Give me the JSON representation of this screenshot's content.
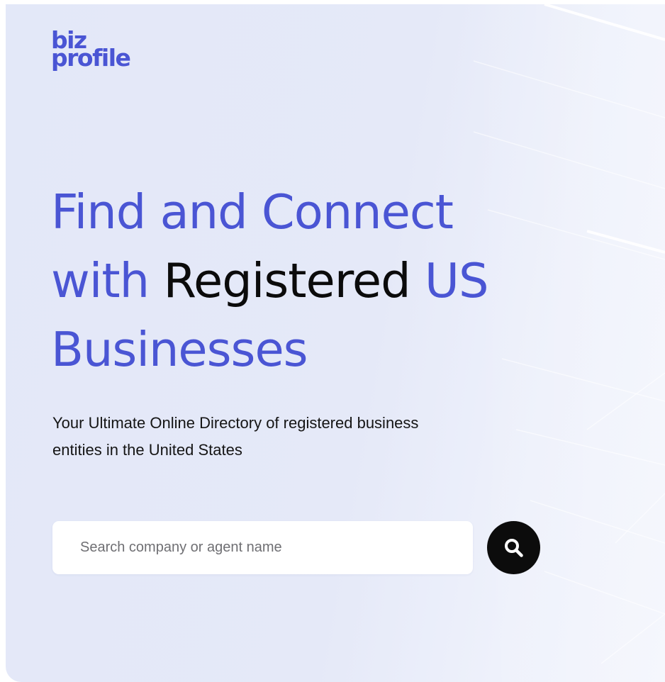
{
  "brand": {
    "logo_line1": "biz",
    "logo_line2": "profile",
    "color": "#4a55d4"
  },
  "hero": {
    "headline_part1": "Find and Connect",
    "headline_part2": "with",
    "headline_highlight": "Registered",
    "headline_part3": "US",
    "headline_part4": "Businesses",
    "subtitle": "Your Ultimate Online Directory of registered business entities in the United States"
  },
  "search": {
    "placeholder": "Search company or agent name",
    "value": "",
    "button_icon": "search-icon"
  },
  "colors": {
    "accent": "#4a55d4",
    "dark": "#0b0b0b",
    "background": "#e4e8f8"
  }
}
